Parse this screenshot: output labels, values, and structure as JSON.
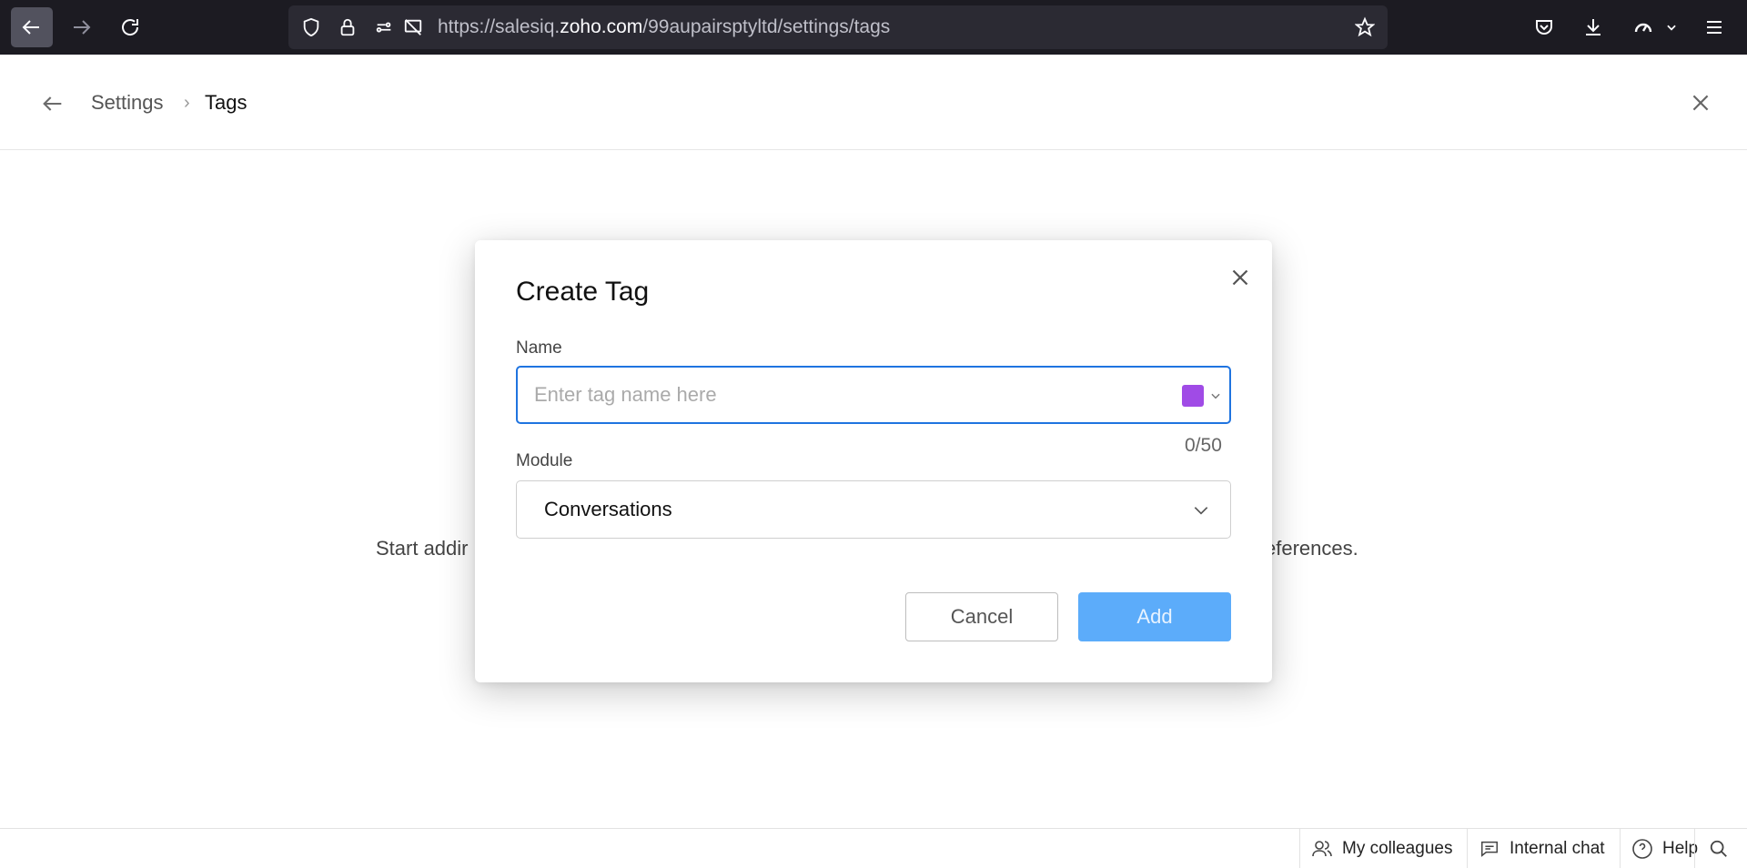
{
  "browser": {
    "url_prefix": "https://salesiq.",
    "url_domain": "zoho.com",
    "url_path": "/99aupairsptyltd/settings/tags"
  },
  "header": {
    "breadcrumb_parent": "Settings",
    "breadcrumb_separator": "›",
    "breadcrumb_current": "Tags"
  },
  "background": {
    "empty_text_left": "Start addir",
    "empty_text_right": "eferences."
  },
  "modal": {
    "title": "Create Tag",
    "name_label": "Name",
    "name_placeholder": "Enter tag name here",
    "name_value": "",
    "tag_color": "#a04be6",
    "char_count": "0/50",
    "module_label": "Module",
    "module_value": "Conversations",
    "cancel_label": "Cancel",
    "add_label": "Add"
  },
  "bottom_bar": {
    "colleagues_label": "My colleagues",
    "internal_chat_label": "Internal chat",
    "help_label": "Help"
  }
}
